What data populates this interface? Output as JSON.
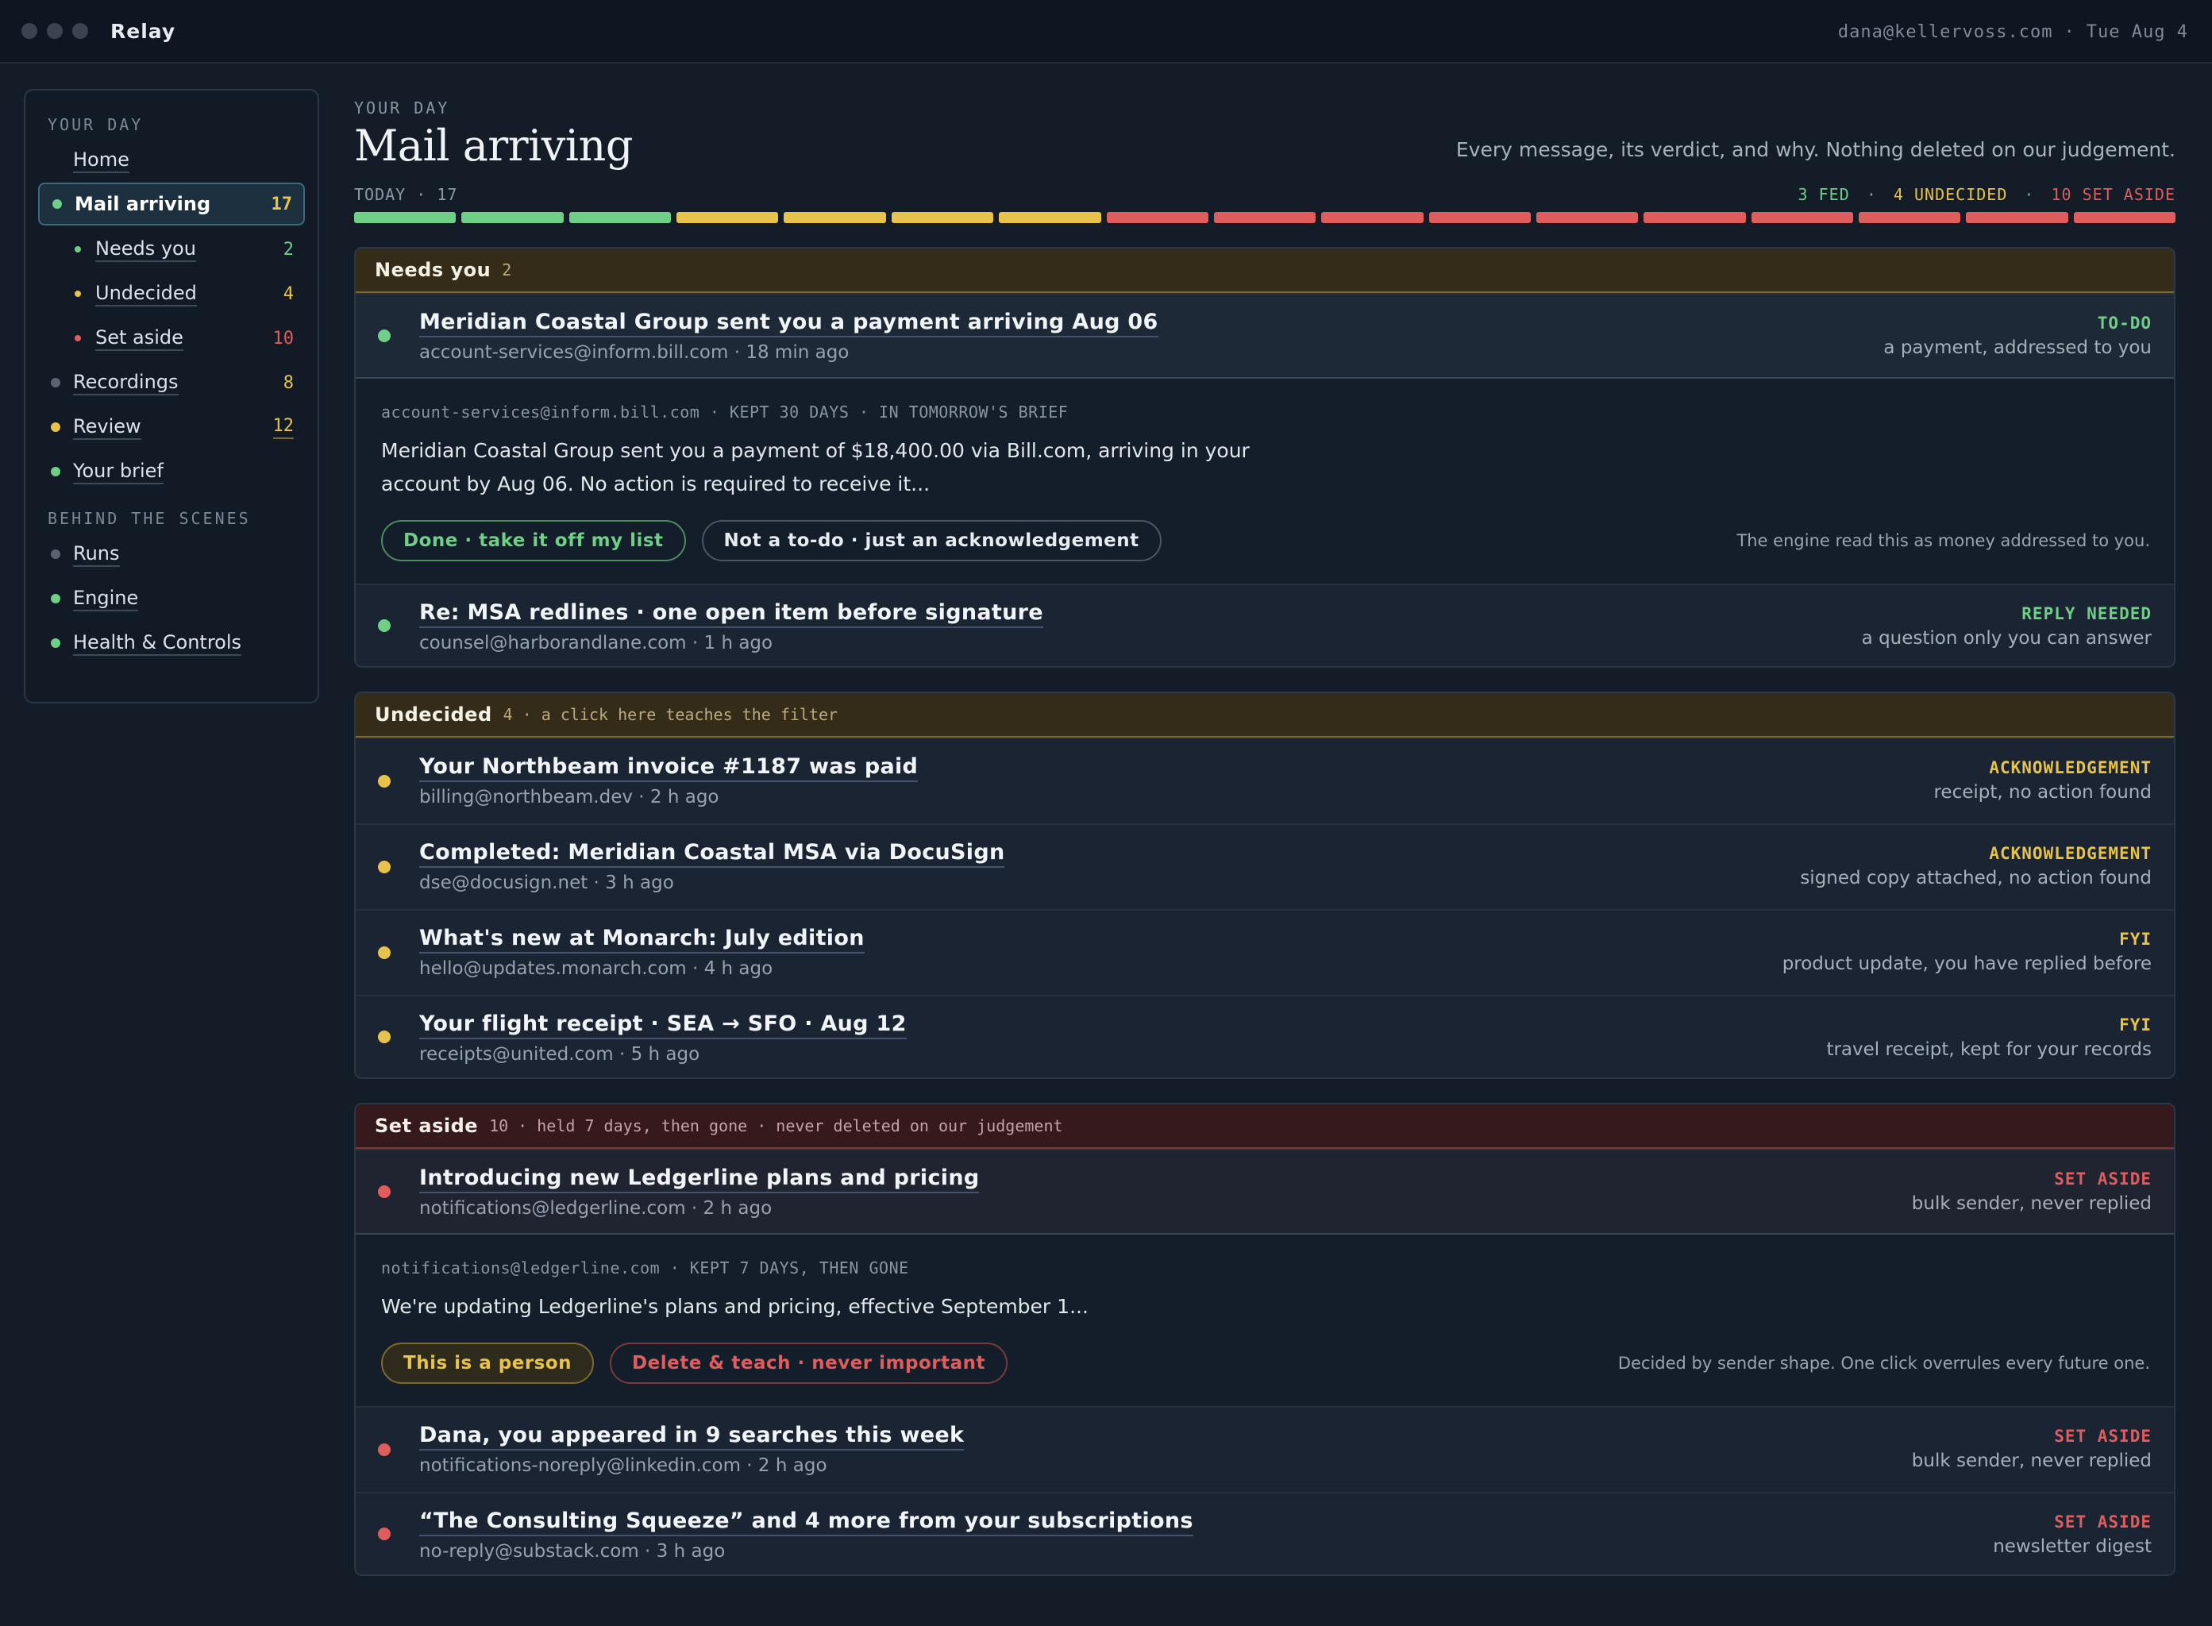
{
  "app": {
    "name": "Relay",
    "account": "dana@kellervoss.com",
    "date": "Tue Aug 4"
  },
  "colors": {
    "green": "#6fcf86",
    "amber": "#e8c34c",
    "red": "#e05d5d",
    "grey": "#5b6470"
  },
  "sidebar": {
    "heading_day": "YOUR DAY",
    "heading_scenes": "BEHIND THE SCENES",
    "home": "Home",
    "mail": {
      "label": "Mail arriving",
      "count": "17"
    },
    "needs": {
      "label": "Needs you",
      "count": "2"
    },
    "undecided": {
      "label": "Undecided",
      "count": "4"
    },
    "set_aside": {
      "label": "Set aside",
      "count": "10"
    },
    "recordings": {
      "label": "Recordings",
      "count": "8"
    },
    "review": {
      "label": "Review",
      "count": "12"
    },
    "brief": {
      "label": "Your brief"
    },
    "runs": {
      "label": "Runs"
    },
    "engine": {
      "label": "Engine"
    },
    "health": {
      "label": "Health & Controls"
    }
  },
  "header": {
    "eyebrow": "YOUR DAY",
    "title": "Mail arriving",
    "tagline": "Every message, its verdict, and why. Nothing deleted on our judgement.",
    "today": "TODAY · 17",
    "fed": "3 FED",
    "undecided": "4 UNDECIDED",
    "set_aside": "10 SET ASIDE",
    "sep": "·",
    "fed_count": 3,
    "undecided_count": 4,
    "set_aside_count": 10
  },
  "needs": {
    "name": "Needs you",
    "count": "2",
    "row1": {
      "subject": "Meridian Coastal Group sent you a payment arriving Aug 06",
      "from": "account-services@inform.bill.com · 18 min ago",
      "tag": "TO-DO",
      "why": "a payment, addressed to you"
    },
    "detail": {
      "meta": "account-services@inform.bill.com · KEPT 30 DAYS · IN TOMORROW'S BRIEF",
      "body": "Meridian Coastal Group sent you a payment of $18,400.00 via Bill.com, arriving in your account by Aug 06. No action is required to receive it...",
      "done": "Done · take it off my list",
      "not_todo": "Not a to-do · just an acknowledgement",
      "note": "The engine read this as money addressed to you."
    },
    "row2": {
      "subject": "Re: MSA redlines · one open item before signature",
      "from": "counsel@harborandlane.com · 1 h ago",
      "tag": "REPLY NEEDED",
      "why": "a question only you can answer"
    }
  },
  "undecided": {
    "name": "Undecided",
    "meta": "4 · a click here teaches the filter",
    "rows": [
      {
        "subject": "Your Northbeam invoice #1187 was paid",
        "from": "billing@northbeam.dev · 2 h ago",
        "tag": "ACKNOWLEDGEMENT",
        "why": "receipt, no action found"
      },
      {
        "subject": "Completed: Meridian Coastal MSA via DocuSign",
        "from": "dse@docusign.net · 3 h ago",
        "tag": "ACKNOWLEDGEMENT",
        "why": "signed copy attached, no action found"
      },
      {
        "subject": "What's new at Monarch: July edition",
        "from": "hello@updates.monarch.com · 4 h ago",
        "tag": "FYI",
        "why": "product update, you have replied before"
      },
      {
        "subject": "Your flight receipt · SEA → SFO · Aug 12",
        "from": "receipts@united.com · 5 h ago",
        "tag": "FYI",
        "why": "travel receipt, kept for your records"
      }
    ]
  },
  "set_aside": {
    "name": "Set aside",
    "meta": "10 · held 7 days, then gone · never deleted on our judgement",
    "row1": {
      "subject": "Introducing new Ledgerline plans and pricing",
      "from": "notifications@ledgerline.com · 2 h ago",
      "tag": "SET ASIDE",
      "why": "bulk sender, never replied"
    },
    "detail": {
      "meta": "notifications@ledgerline.com · KEPT 7 DAYS, THEN GONE",
      "body": "We're updating Ledgerline's plans and pricing, effective September 1...",
      "person": "This is a person",
      "delete": "Delete & teach · never important",
      "note": "Decided by sender shape. One click overrules every future one."
    },
    "row2": {
      "subject": "Dana, you appeared in 9 searches this week",
      "from": "notifications-noreply@linkedin.com · 2 h ago",
      "tag": "SET ASIDE",
      "why": "bulk sender, never replied"
    },
    "row3": {
      "subject": "“The Consulting Squeeze” and 4 more from your subscriptions",
      "from": "no-reply@substack.com · 3 h ago",
      "tag": "SET ASIDE",
      "why": "newsletter digest"
    }
  }
}
